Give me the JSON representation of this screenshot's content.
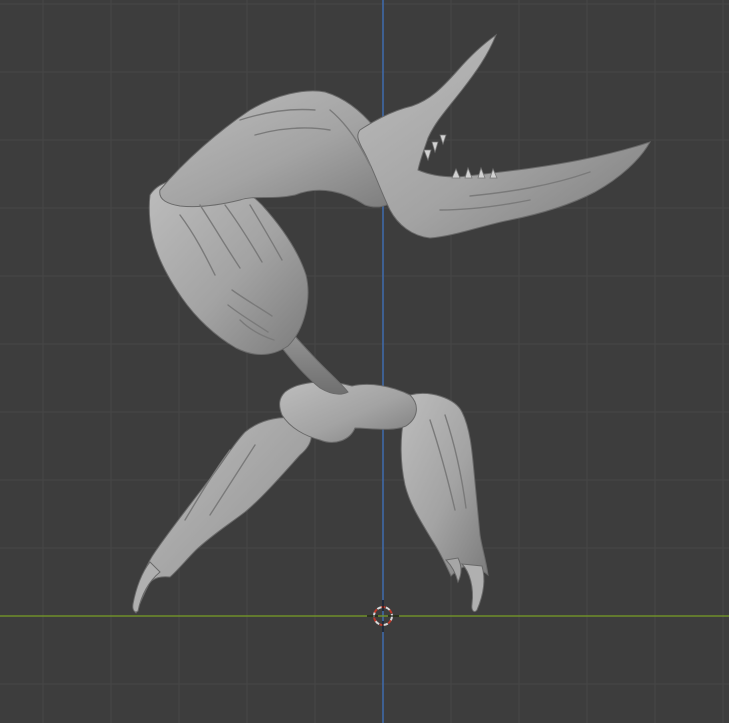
{
  "viewport": {
    "view": "front-orthographic",
    "background_color": "#3d3d3d",
    "grid": {
      "minor_color": "#474747",
      "major_color": "#4f4f4f"
    },
    "axes": {
      "x_axis_color": "#6f8f2a",
      "z_axis_color": "#3f69a8"
    },
    "cursor": {
      "icon": "3d-cursor-icon",
      "ring_color_a": "#d8d8d8",
      "ring_color_b": "#c0392b"
    },
    "object": {
      "name": "sculpted-creature-mesh",
      "material_color": "#a9a9a9",
      "shading": "matcap-clay"
    }
  }
}
